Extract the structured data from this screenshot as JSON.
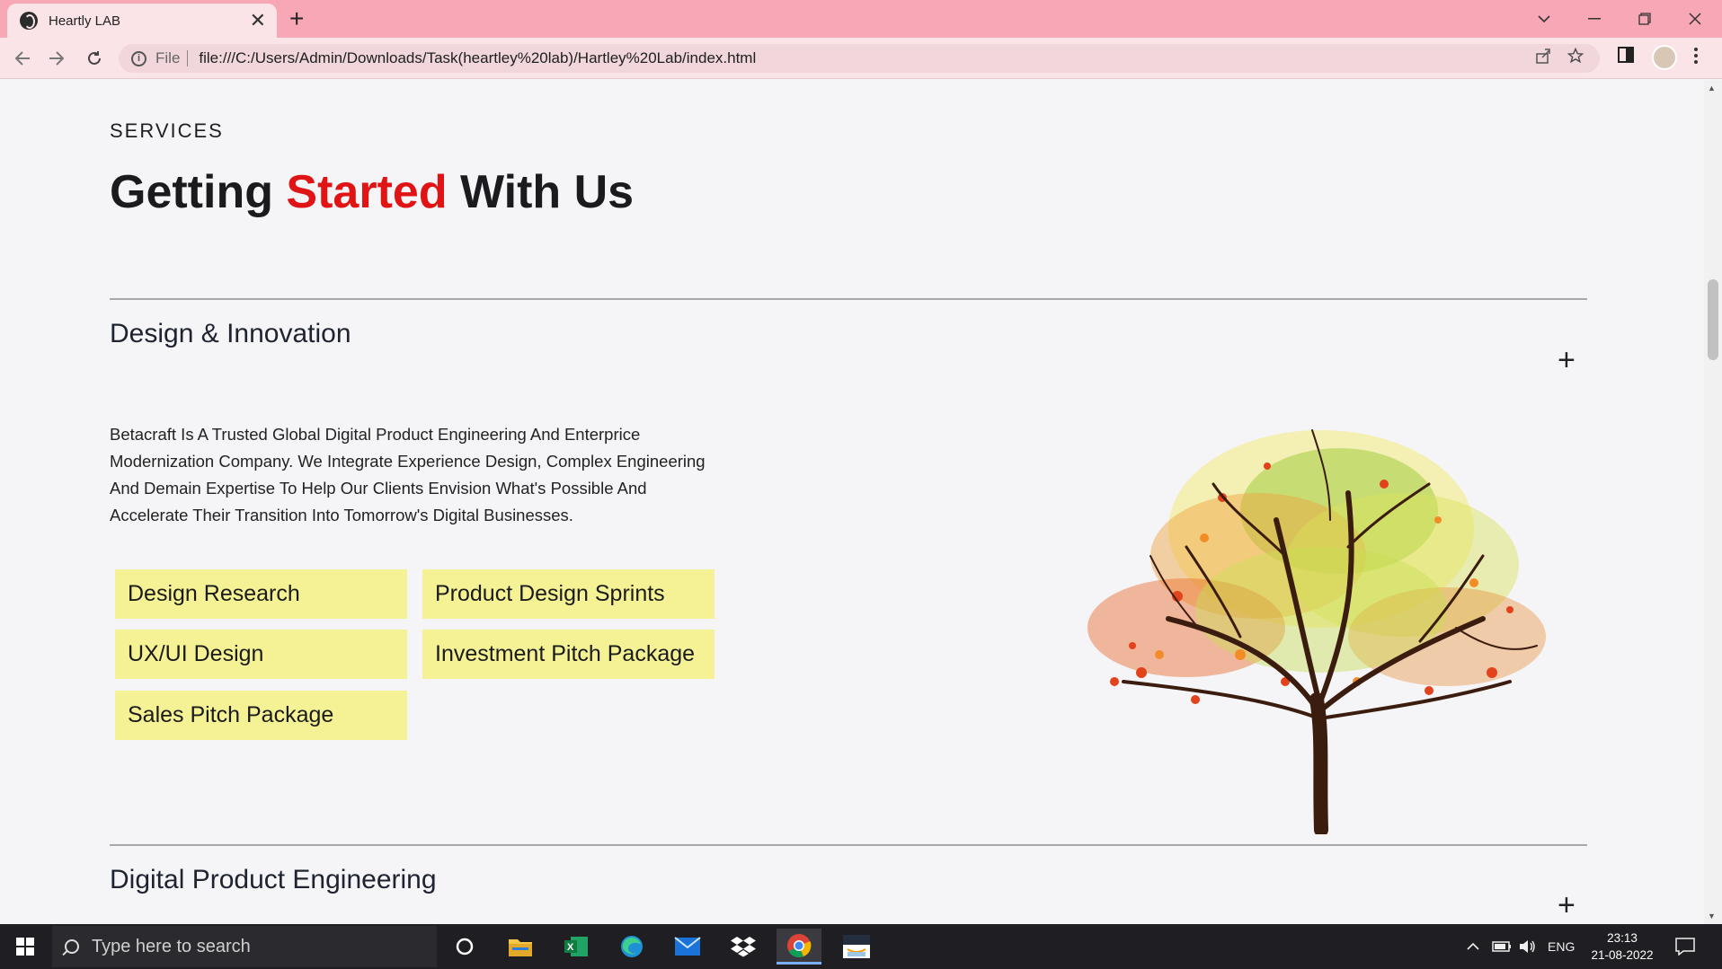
{
  "browser": {
    "tab_title": "Heartly LAB",
    "tab_close": "✕",
    "new_tab": "+",
    "url_scheme": "File",
    "url": "file:///C:/Users/Admin/Downloads/Task(heartley%20lab)/Hartley%20Lab/index.html",
    "icons": [
      "globe-icon",
      "back-icon",
      "forward-icon",
      "reload-icon",
      "info-icon",
      "share-icon",
      "star-icon",
      "side-panel-icon",
      "profile-avatar",
      "menu-icon",
      "minimize-icon",
      "restore-icon",
      "close-icon",
      "tab-search-icon"
    ]
  },
  "page": {
    "eyebrow": "SERVICES",
    "headline": {
      "part1": "Getting ",
      "accent": "Started",
      "part2": " With Us"
    },
    "accent_color": "#e01414",
    "sections": [
      {
        "title": "Design & Innovation",
        "toggle": "+",
        "description": "Betacraft Is A Trusted Global Digital Product Engineering And Enterprice Modernization Company. We Integrate Experience Design, Complex Engineering And Demain Expertise To Help Our Clients Envision What's Possible And Accelerate Their Transition Into Tomorrow's Digital Businesses.",
        "chips": [
          "Design Research",
          "Product Design Sprints",
          "UX/UI Design",
          "Investment Pitch Package",
          "Sales Pitch Package"
        ],
        "chip_color": "#f5f296"
      },
      {
        "title": "Digital Product Engineering",
        "toggle": "+"
      }
    ]
  },
  "taskbar": {
    "search_placeholder": "Type here to search",
    "apps": [
      "cortana-icon",
      "file-explorer-icon",
      "excel-icon",
      "edge-icon",
      "mail-icon",
      "dropbox-icon",
      "chrome-icon",
      "amazon-icon"
    ],
    "tray_lang": "ENG",
    "time": "23:13",
    "date": "21-08-2022"
  }
}
